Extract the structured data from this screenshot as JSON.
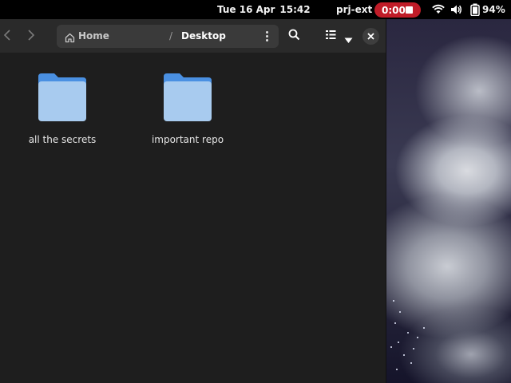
{
  "topbar": {
    "date": "Tue 16 Apr",
    "time": "15:42",
    "project": "prj-ext",
    "recording_time": "0:00",
    "battery": "94%",
    "icons": [
      "wifi-icon",
      "volume-icon",
      "battery-icon"
    ],
    "record_color": "#c01c28"
  },
  "window": {
    "pathbar": {
      "home_label": "Home",
      "separator": "/",
      "current": "Desktop"
    },
    "icons": [
      "back-icon",
      "forward-icon",
      "home-icon",
      "kebab-menu-icon",
      "search-icon",
      "list-view-icon",
      "dropdown-arrow-icon",
      "close-icon"
    ],
    "folders": [
      {
        "name": "all the secrets"
      },
      {
        "name": "important repo"
      }
    ],
    "folder_color": "#a8cbef",
    "folder_tab_color": "#4a90e2"
  }
}
